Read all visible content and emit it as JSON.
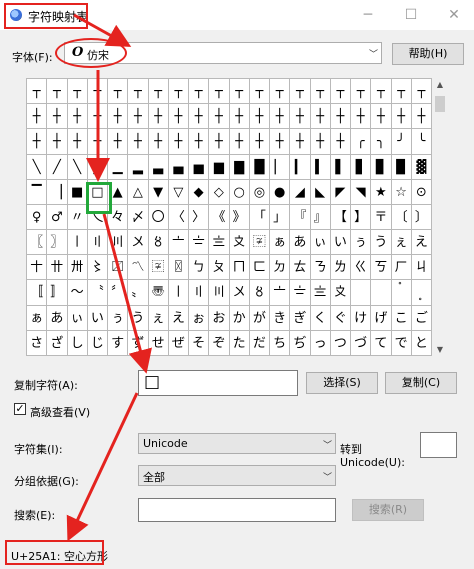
{
  "window": {
    "title": "字符映射表",
    "minimize_icon": "─",
    "maximize_icon": "☐",
    "close_icon": "✕"
  },
  "font_row": {
    "label": "字体(F):",
    "font_icon": "O",
    "font_value": "仿宋",
    "help_button": "帮助(H)"
  },
  "grid": {
    "rows": [
      [
        "┬",
        "┬",
        "┬",
        "┬",
        "┬",
        "┬",
        "┬",
        "┬",
        "┬",
        "┬",
        "┬",
        "┬",
        "┬",
        "┬",
        "┬",
        "┬",
        "┬",
        "┬",
        "┬",
        "┬"
      ],
      [
        "┼",
        "┼",
        "┼",
        "┼",
        "┼",
        "┼",
        "┼",
        "┼",
        "┼",
        "┼",
        "┼",
        "┼",
        "┼",
        "┼",
        "┼",
        "┼",
        "┼",
        "┼",
        "┼",
        "┼"
      ],
      [
        "┼",
        "┼",
        "┼",
        "┼",
        "┼",
        "┼",
        "┼",
        "┼",
        "┼",
        "┼",
        "┼",
        "┼",
        "┼",
        "┼",
        "┼",
        "┼",
        "╭",
        "╮",
        "╯",
        "╰"
      ],
      [
        "╲",
        "╱",
        "╲",
        "╳",
        "▁",
        "▂",
        "▃",
        "▄",
        "▅",
        "▆",
        "▇",
        "█",
        "▏",
        "▎",
        "▍",
        "▌",
        "▋",
        "▊",
        "▉",
        "▓"
      ],
      [
        "▔",
        "▕",
        "■",
        "□",
        "▲",
        "△",
        "▼",
        "▽",
        "◆",
        "◇",
        "○",
        "◎",
        "●",
        "◢",
        "◣",
        "◤",
        "◥",
        "★",
        "☆",
        "⊙"
      ],
      [
        "♀",
        "♂",
        "〃",
        "乀",
        "々",
        "〆",
        "〇",
        "〈",
        "〉",
        "《",
        "》",
        "「",
        "」",
        "『",
        "』",
        "【",
        "】",
        "〒",
        "〔",
        "〕"
      ],
      [
        "〖",
        "〗",
        "〡",
        "〢",
        "〣",
        "〤",
        "〥",
        "〦",
        "〧",
        "〨",
        "〩",
        "〾",
        "ぁ",
        "あ",
        "ぃ",
        "い",
        "ぅ",
        "う",
        "ぇ",
        "え"
      ],
      [
        "〸",
        "〹",
        "〺",
        "〻",
        "〼",
        "〽",
        "〾",
        "〿",
        "ㄅ",
        "ㄆ",
        "ㄇ",
        "ㄈ",
        "ㄉ",
        "ㄊ",
        "ㄋ",
        "ㄌ",
        "ㄍ",
        "ㄎ",
        "ㄏ",
        "ㄐ"
      ],
      [
        "〚",
        "〛",
        "〜",
        "〝",
        "〞",
        "〟",
        "〠",
        "〡",
        "〢",
        "〣",
        "〤",
        "〥",
        "〦",
        "〧",
        "〨",
        "〩",
        "〪",
        "〫",
        "〬",
        "〭"
      ],
      [
        "ぁ",
        "あ",
        "ぃ",
        "い",
        "ぅ",
        "う",
        "ぇ",
        "え",
        "ぉ",
        "お",
        "か",
        "が",
        "き",
        "ぎ",
        "く",
        "ぐ",
        "け",
        "げ",
        "こ",
        "ご"
      ],
      [
        "さ",
        "ざ",
        "し",
        "じ",
        "す",
        "ず",
        "せ",
        "ぜ",
        "そ",
        "ぞ",
        "た",
        "だ",
        "ち",
        "ぢ",
        "っ",
        "つ",
        "づ",
        "て",
        "で",
        "と"
      ]
    ]
  },
  "copy_row": {
    "label": "复制字符(A):",
    "value": "□",
    "select_button": "选择(S)",
    "copy_button": "复制(C)"
  },
  "advanced": {
    "label": "高级查看(V)",
    "checked_mark": "✓"
  },
  "charset": {
    "label": "字符集(I):",
    "value": "Unicode",
    "goto_label_1": "转到",
    "goto_label_2": "Unicode(U):"
  },
  "groupby": {
    "label": "分组依据(G):",
    "value": "全部"
  },
  "search": {
    "label": "搜索(E):",
    "button": "搜索(R)"
  },
  "status": {
    "text": "U+25A1: 空心方形"
  },
  "colors": {
    "annotation_red": "#e4231f",
    "annotation_green": "#22a83a"
  }
}
